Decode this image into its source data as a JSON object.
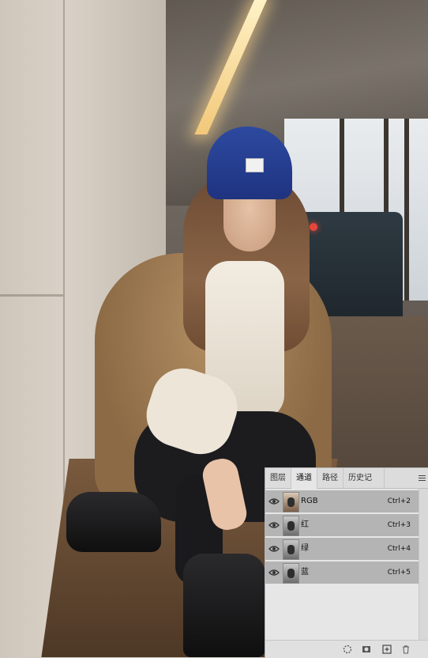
{
  "channels_panel": {
    "tabs": [
      {
        "label": "图层",
        "active": false
      },
      {
        "label": "通道",
        "active": true
      },
      {
        "label": "路径",
        "active": false
      },
      {
        "label": "历史记录",
        "active": false
      }
    ],
    "menu_icon": "panel-menu-icon",
    "channels": [
      {
        "name": "RGB",
        "shortcut": "Ctrl+2"
      },
      {
        "name": "红",
        "shortcut": "Ctrl+3"
      },
      {
        "name": "绿",
        "shortcut": "Ctrl+4"
      },
      {
        "name": "蓝",
        "shortcut": "Ctrl+5"
      }
    ],
    "bottom_icons": [
      "load-selection-icon",
      "save-selection-icon",
      "new-channel-icon",
      "trash-icon"
    ],
    "colors": {
      "panel_bg": "#e6e6e6",
      "row_selected": "#b4b4b4",
      "beanie": "#2d4aa0"
    }
  }
}
